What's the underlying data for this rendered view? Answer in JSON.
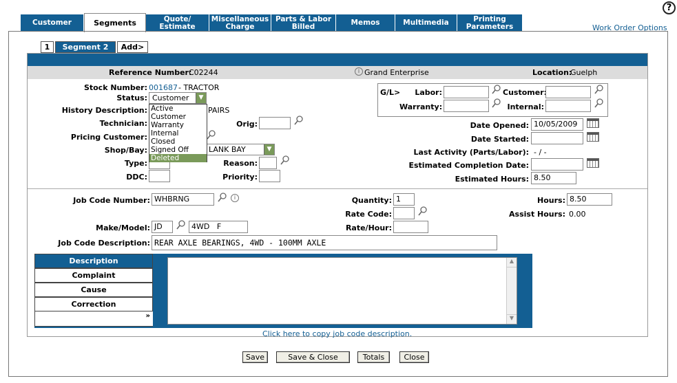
{
  "help": {
    "label": "?"
  },
  "tabs": [
    {
      "label": "Customer"
    },
    {
      "label": "Segments"
    },
    {
      "label": "Quote/\nEstimate"
    },
    {
      "label": "Miscellaneous\nCharge"
    },
    {
      "label": "Parts & Labor\nBilled"
    },
    {
      "label": "Memos"
    },
    {
      "label": "Multimedia"
    },
    {
      "label": "Printing\nParameters"
    }
  ],
  "work_order_options": "Work Order Options",
  "segment_tabs": [
    {
      "label": "1"
    },
    {
      "label": "Segment 2"
    },
    {
      "label": "Add>"
    }
  ],
  "header": {
    "reference_label": "Reference Number:",
    "reference_value": "C02244",
    "customer_name": "Grand Enterprise",
    "location_label": "Location:",
    "location_value": "Guelph"
  },
  "fields": {
    "stock_label": "Stock Number:",
    "stock_value": "001687",
    "stock_desc": "- TRACTOR",
    "status_label": "Status:",
    "status_value": "Customer",
    "history_label": "History Description:",
    "history_value": "PAIRS",
    "technician_label": "Technician:",
    "orig_label": "Orig:",
    "pricing_label": "Pricing Customer:",
    "shopbay_label": "Shop/Bay:",
    "shopbay_value": "LANK BAY",
    "type_label": "Type:",
    "reason_label": "Reason:",
    "ddc_label": "DDC:",
    "priority_label": "Priority:",
    "gl_label": "G/L>",
    "labor_label": "Labor:",
    "customer_label": "Customer:",
    "warranty_label": "Warranty:",
    "internal_label": "Internal:",
    "date_opened_label": "Date Opened:",
    "date_opened_value": "10/05/2009",
    "date_started_label": "Date Started:",
    "last_activity_label": "Last Activity (Parts/Labor):",
    "last_activity_value": "- / -",
    "est_completion_label": "Estimated Completion Date:",
    "est_hours_label": "Estimated Hours:",
    "est_hours_value": "8.50"
  },
  "status_options": [
    "Active",
    "Customer",
    "Warranty",
    "Internal",
    "Closed",
    "Signed Off",
    "Deleted"
  ],
  "job": {
    "job_code_label": "Job Code Number:",
    "job_code_value": "WHBRNG",
    "quantity_label": "Quantity:",
    "quantity_value": "1",
    "hours_label": "Hours:",
    "hours_value": "8.50",
    "rate_code_label": "Rate Code:",
    "assist_label": "Assist Hours:",
    "assist_value": "0.00",
    "make_model_label": "Make/Model:",
    "make_value": "JD",
    "model_value": "4WD   F",
    "rate_hour_label": "Rate/Hour:",
    "desc_label": "Job Code Description:",
    "desc_value": "REAR AXLE BEARINGS, 4WD - 100MM AXLE"
  },
  "desc_tabs": [
    {
      "label": "Description"
    },
    {
      "label": "Complaint"
    },
    {
      "label": "Cause"
    },
    {
      "label": "Correction"
    }
  ],
  "expand_label": "»",
  "copy_link": "Click here to copy job code description.",
  "buttons": {
    "save": "Save",
    "save_close": "Save & Close",
    "totals": "Totals",
    "close": "Close"
  },
  "colors": {
    "primary": "#135f93",
    "selected_option": "#7a9a5a"
  }
}
